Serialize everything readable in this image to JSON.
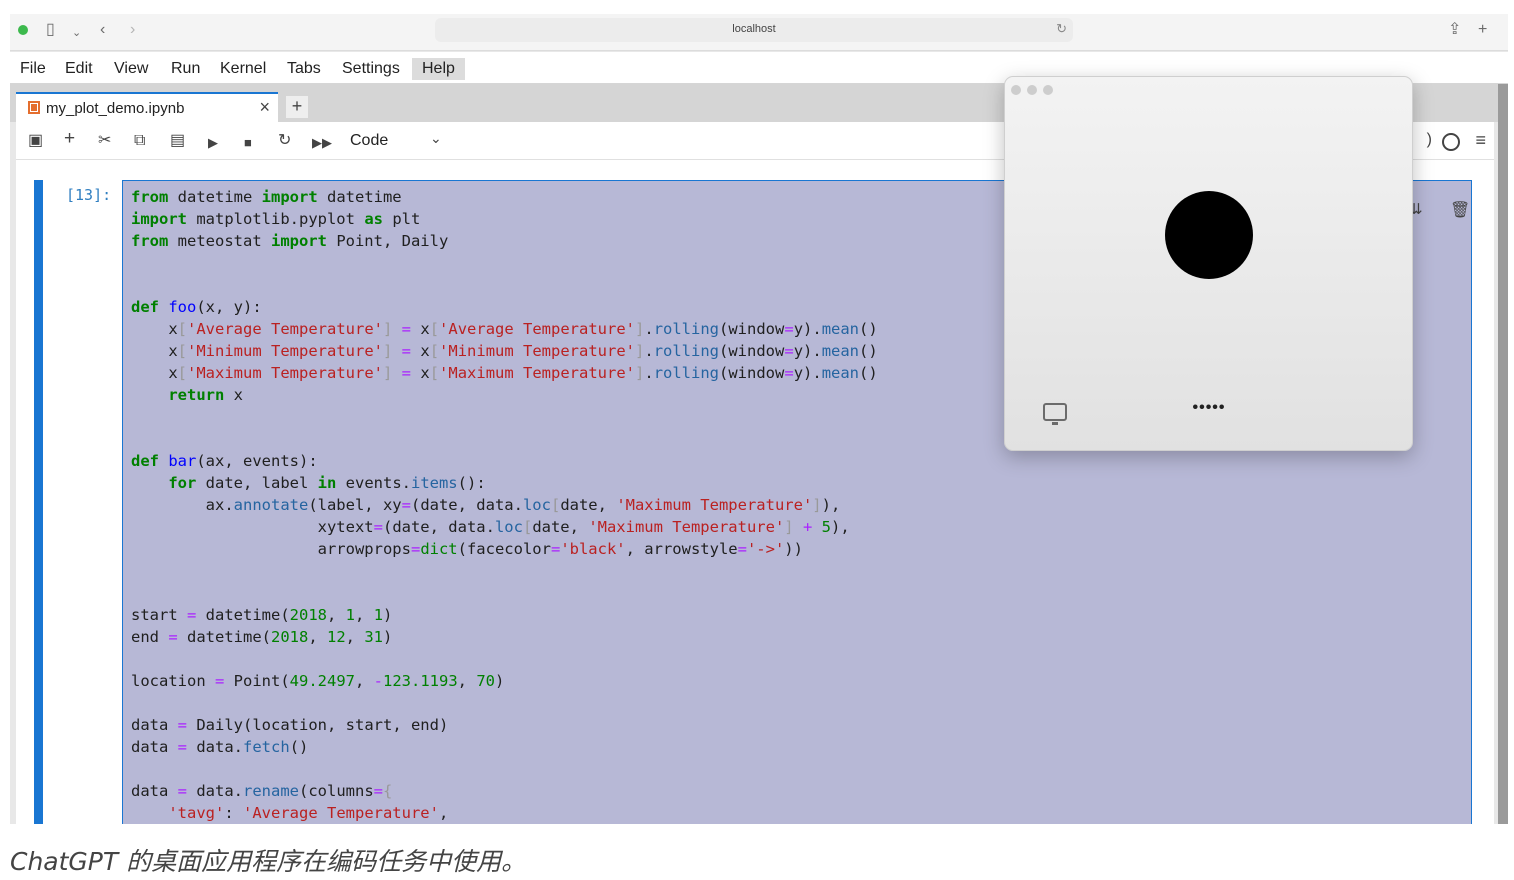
{
  "browser": {
    "url": "localhost"
  },
  "menubar": {
    "items": [
      "File",
      "Edit",
      "View",
      "Run",
      "Kernel",
      "Tabs",
      "Settings",
      "Help"
    ],
    "active": "Help"
  },
  "tabs": {
    "notebook_title": "my_plot_demo.ipynb",
    "close": "×",
    "add": "+"
  },
  "toolbar": {
    "cell_type": "Code",
    "kernel_status_text": ")"
  },
  "cell": {
    "prompt": "[13]:"
  },
  "chatgpt": {
    "more": "•••••"
  },
  "caption": "ChatGPT 的桌面应用程序在编码任务中使用。"
}
